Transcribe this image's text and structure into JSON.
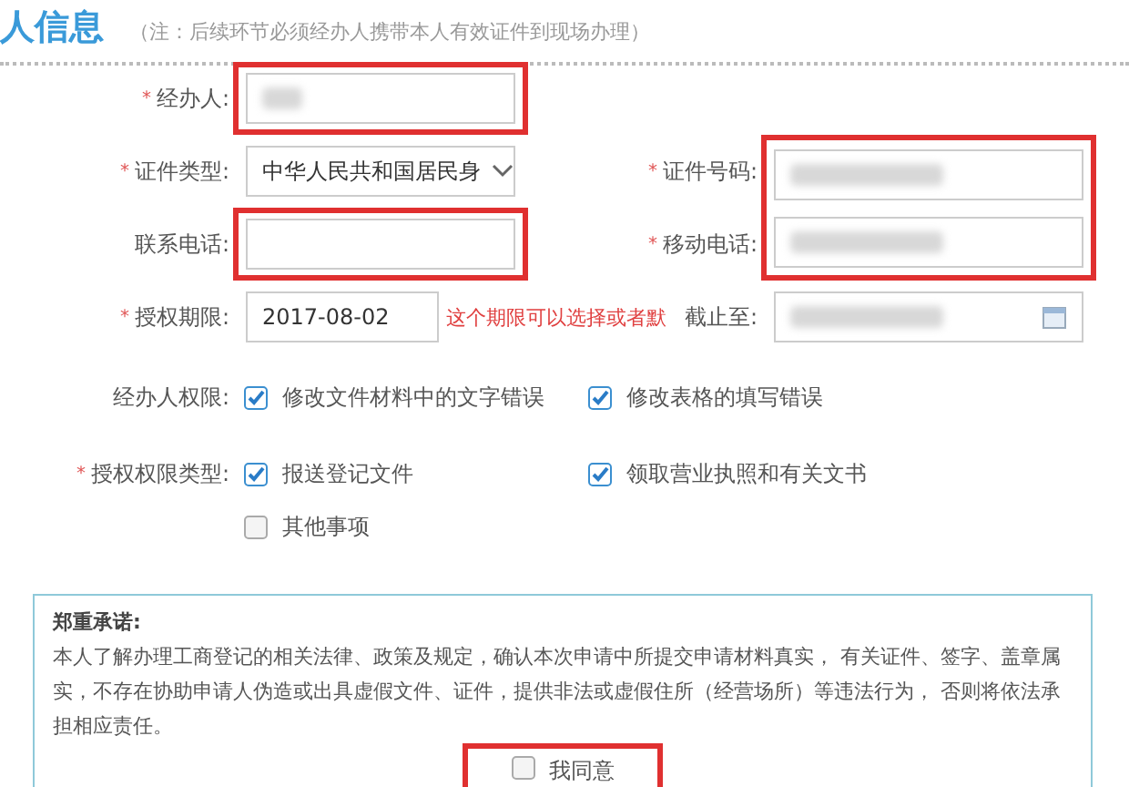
{
  "section": {
    "title": "人信息",
    "note": "（注：后续环节必须经办人携带本人有效证件到现场办理）"
  },
  "rows": [
    {
      "left": {
        "label": "经办人:",
        "required_mark": "*",
        "kind": "text",
        "redacted": true,
        "highlighted": true
      },
      "right": null
    },
    {
      "left": {
        "label": "证件类型:",
        "required_mark": "*",
        "kind": "select",
        "value": "中华人民共和国居民身",
        "highlighted": false
      },
      "right": {
        "label": "证件号码:",
        "required_mark": "*",
        "kind": "text",
        "redacted": true,
        "highlighted": true
      }
    },
    {
      "left": {
        "label": "联系电话:",
        "kind": "text",
        "highlighted": true
      },
      "right": {
        "label": "移动电话:",
        "required_mark": "*",
        "kind": "text",
        "redacted": true,
        "highlighted": true
      }
    },
    {
      "left": {
        "label": "授权期限:",
        "required_mark": "*",
        "kind": "text",
        "value": "2017-08-02",
        "highlighted": false,
        "annotation": "这个期限可以选择或者默"
      },
      "right": {
        "label": "截止至:",
        "kind": "date",
        "redacted": true,
        "highlighted": false
      }
    }
  ],
  "permissions": [
    {
      "label": "经办人权限:",
      "options": [
        {
          "text": "修改文件材料中的文字错误",
          "checked": true
        },
        {
          "text": "修改表格的填写错误",
          "checked": true
        }
      ]
    },
    {
      "label": "授权权限类型:",
      "required_mark": "*",
      "options": [
        {
          "text": "报送登记文件",
          "checked": true
        },
        {
          "text": "领取营业执照和有关文书",
          "checked": true
        },
        {
          "text": "其他事项",
          "checked": false
        }
      ]
    }
  ],
  "pledge": {
    "title": "郑重承诺:",
    "body": "本人了解办理工商登记的相关法律、政策及规定，确认本次申请中所提交申请材料真实， 有关证件、签字、盖章属实，不存在协助申请人伪造或出具虚假文件、证件，提供非法或虚假住所（经营场所）等违法行为， 否则将依法承担相应责任。",
    "agree": {
      "text": "我同意",
      "checked": false,
      "highlighted": true
    }
  }
}
